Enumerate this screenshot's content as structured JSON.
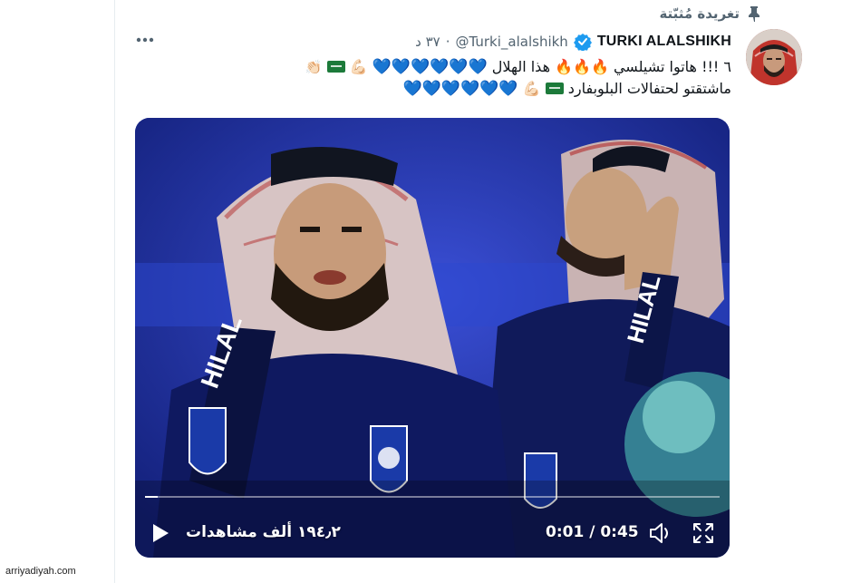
{
  "pinned": {
    "label": "تغريدة مُثبّتة",
    "icon": "pin-icon"
  },
  "tweet": {
    "display_name": "TURKI ALALSHIKH",
    "handle": "@Turki_alalshikh",
    "separator": "·",
    "timestamp": "٣٧ د",
    "verified": true,
    "line1_number": "٦",
    "line1_text": "!!! هاتوا تشيلسي",
    "line1_text2": "هذا الهلال",
    "line2_text": "ماشتقتو لحتفالات البلوبفارد",
    "fire_emoji": "🔥🔥🔥",
    "hearts_line1": "💙💙💙💙💙💙",
    "hearts_line2": "💙💙💙💙💙💙",
    "clap_emoji": "👏🏻",
    "flex_emoji": "💪🏻",
    "more_icon": "more-icon"
  },
  "video": {
    "current_time": "0:01",
    "duration": "0:45",
    "time_separator": " / ",
    "views": "١٩٤٫٢ ألف مشاهدات",
    "progress_fraction": 0.022
  },
  "colors": {
    "accent": "#1d9bf0",
    "text_primary": "#0f1419",
    "text_secondary": "#536471",
    "heart_blue": "#5eb6ee"
  },
  "watermark": "arriyadiyah.com"
}
